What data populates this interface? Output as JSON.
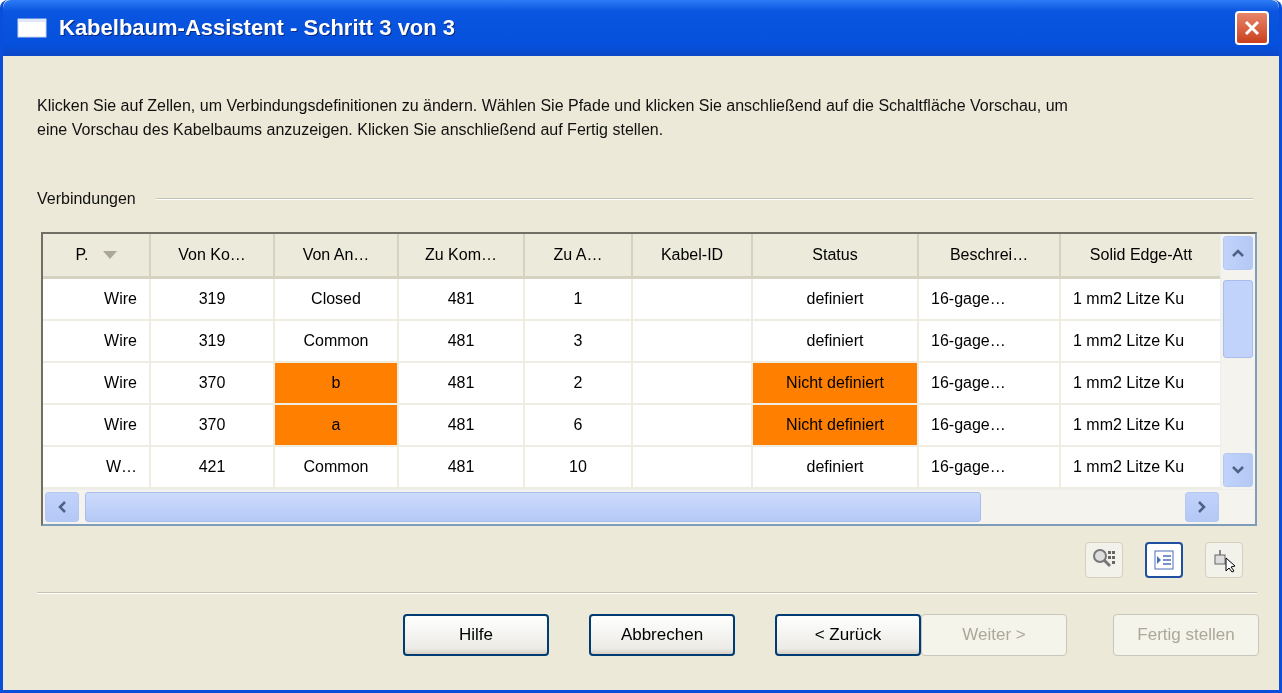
{
  "window": {
    "title": "Kabelbaum-Assistent - Schritt 3 von 3"
  },
  "instructions": "Klicken Sie auf Zellen, um Verbindungsdefinitionen zu ändern. Wählen Sie Pfade und klicken Sie anschließend auf die Schaltfläche Vorschau, um eine Vorschau des Kabelbaums anzuzeigen. Klicken Sie anschließend auf Fertig stellen.",
  "group_label": "Verbindungen",
  "table": {
    "columns": [
      {
        "label": "P.",
        "sorted": true
      },
      {
        "label": "Von Ko…",
        "sorted": false
      },
      {
        "label": "Von An…",
        "sorted": false
      },
      {
        "label": "Zu Kom…",
        "sorted": false
      },
      {
        "label": "Zu A…",
        "sorted": false
      },
      {
        "label": "Kabel-ID",
        "sorted": false
      },
      {
        "label": "Status",
        "sorted": false
      },
      {
        "label": "Beschrei…",
        "sorted": false
      },
      {
        "label": "Solid Edge-Att",
        "sorted": false
      }
    ],
    "rows": [
      {
        "cells": [
          {
            "text": "Wire",
            "highlighted": false
          },
          {
            "text": "319",
            "highlighted": false
          },
          {
            "text": "Closed",
            "highlighted": false
          },
          {
            "text": "481",
            "highlighted": false
          },
          {
            "text": "1",
            "highlighted": false
          },
          {
            "highlighted": false
          },
          {
            "text": "definiert",
            "highlighted": false
          },
          {
            "text": "16-gage…",
            "highlighted": false
          },
          {
            "text": "1 mm2 Litze Ku",
            "highlighted": false
          }
        ]
      },
      {
        "cells": [
          {
            "text": "Wire",
            "highlighted": false
          },
          {
            "text": "319",
            "highlighted": false
          },
          {
            "text": "Common",
            "highlighted": false
          },
          {
            "text": "481",
            "highlighted": false
          },
          {
            "text": "3",
            "highlighted": false
          },
          {
            "highlighted": false
          },
          {
            "text": "definiert",
            "highlighted": false
          },
          {
            "text": "16-gage…",
            "highlighted": false
          },
          {
            "text": "1 mm2 Litze Ku",
            "highlighted": false
          }
        ]
      },
      {
        "cells": [
          {
            "text": "Wire",
            "highlighted": false
          },
          {
            "text": "370",
            "highlighted": false
          },
          {
            "text": "b",
            "highlighted": true
          },
          {
            "text": "481",
            "highlighted": false
          },
          {
            "text": "2",
            "highlighted": false
          },
          {
            "highlighted": false
          },
          {
            "text": "Nicht definiert",
            "highlighted": true
          },
          {
            "text": "16-gage…",
            "highlighted": false
          },
          {
            "text": "1 mm2 Litze Ku",
            "highlighted": false
          }
        ]
      },
      {
        "cells": [
          {
            "text": "Wire",
            "highlighted": false
          },
          {
            "text": "370",
            "highlighted": false
          },
          {
            "text": "a",
            "highlighted": true
          },
          {
            "text": "481",
            "highlighted": false
          },
          {
            "text": "6",
            "highlighted": false
          },
          {
            "highlighted": false
          },
          {
            "text": "Nicht definiert",
            "highlighted": true
          },
          {
            "text": "16-gage…",
            "highlighted": false
          },
          {
            "text": "1 mm2 Litze Ku",
            "highlighted": false
          }
        ]
      },
      {
        "cells": [
          {
            "text": "W…",
            "highlighted": false
          },
          {
            "text": "421",
            "highlighted": false
          },
          {
            "text": "Common",
            "highlighted": false
          },
          {
            "text": "481",
            "highlighted": false
          },
          {
            "text": "10",
            "highlighted": false
          },
          {
            "highlighted": false
          },
          {
            "text": "definiert",
            "highlighted": false
          },
          {
            "text": "16-gage…",
            "highlighted": false
          },
          {
            "text": "1 mm2 Litze Ku",
            "highlighted": false
          }
        ]
      }
    ]
  },
  "tools": [
    {
      "kind": "search",
      "selected": false
    },
    {
      "kind": "list",
      "selected": true
    },
    {
      "kind": "pick",
      "selected": false
    }
  ],
  "buttons": [
    {
      "label": "Hilfe",
      "disabled": false
    },
    {
      "label": "Abbrechen",
      "disabled": false
    },
    {
      "label": "< Zurück",
      "disabled": false
    },
    {
      "label": "Weiter >",
      "disabled": true
    },
    {
      "label": "Fertig stellen",
      "disabled": true
    }
  ]
}
